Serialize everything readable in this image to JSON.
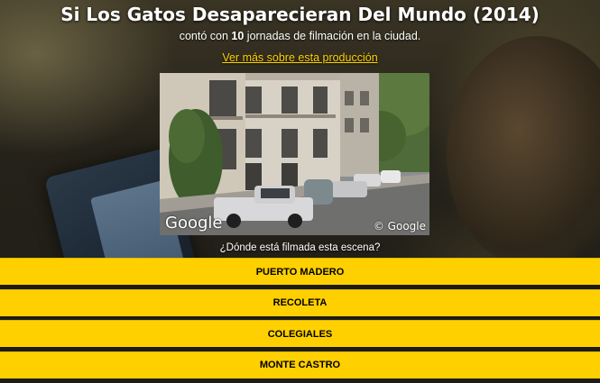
{
  "page": {
    "title": "Si Los Gatos Desaparecieran Del Mundo (2014)",
    "subtitle_prefix": "contó con ",
    "subtitle_count": "10",
    "subtitle_suffix": " jornadas de filmación en la ciudad.",
    "more_link": "Ver más sobre esta producción"
  },
  "street_view": {
    "logo": "Google",
    "copyright": "© Google"
  },
  "quiz": {
    "question": "¿Dónde está filmada esta escena?",
    "options": [
      "PUERTO MADERO",
      "RECOLETA",
      "COLEGIALES",
      "MONTE CASTRO"
    ]
  },
  "colors": {
    "accent": "#ffd000",
    "link": "#ffd200"
  }
}
